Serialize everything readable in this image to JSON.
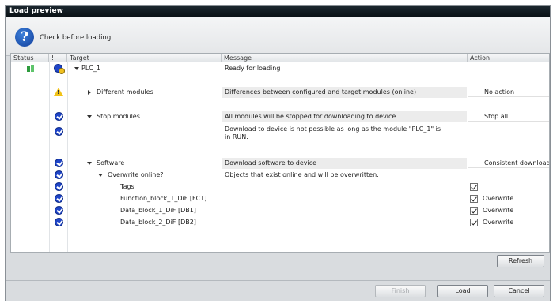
{
  "window": {
    "title": "Load preview"
  },
  "header": {
    "text": "Check before loading"
  },
  "columns": {
    "status": "Status",
    "bang": "!",
    "target": "Target",
    "message": "Message",
    "action": "Action"
  },
  "rows": {
    "plc": {
      "target": "PLC_1",
      "message": "Ready for loading"
    },
    "diff": {
      "target": "Different modules",
      "message": "Differences between configured and target modules (online)",
      "action": "No action"
    },
    "stop": {
      "target": "Stop modules",
      "message": "All modules will be stopped for downloading to device.",
      "action": "Stop all"
    },
    "stop_info": {
      "message_line1": "Download to device is not possible as long as the module \"PLC_1\" is",
      "message_line2": "in RUN."
    },
    "software": {
      "target": "Software",
      "message": "Download software to device",
      "action": "Consistent download"
    },
    "overwrite": {
      "target": "Overwrite online?",
      "message": "Objects that exist online and will be overwritten."
    },
    "tags": {
      "target": "Tags"
    },
    "fb1": {
      "target": "Function_block_1_DiF [FC1]",
      "action": "Overwrite"
    },
    "db1": {
      "target": "Data_block_1_DiF [DB1]",
      "action": "Overwrite"
    },
    "db2": {
      "target": "Data_block_2_DiF [DB2]",
      "action": "Overwrite"
    }
  },
  "buttons": {
    "refresh": "Refresh",
    "finish": "Finish",
    "load": "Load",
    "cancel": "Cancel"
  },
  "colors": {
    "title_bar": "#0b1216",
    "status_ok": "#1f45c8",
    "warning": "#f2c318",
    "plc_green": "#2e9b3e"
  }
}
